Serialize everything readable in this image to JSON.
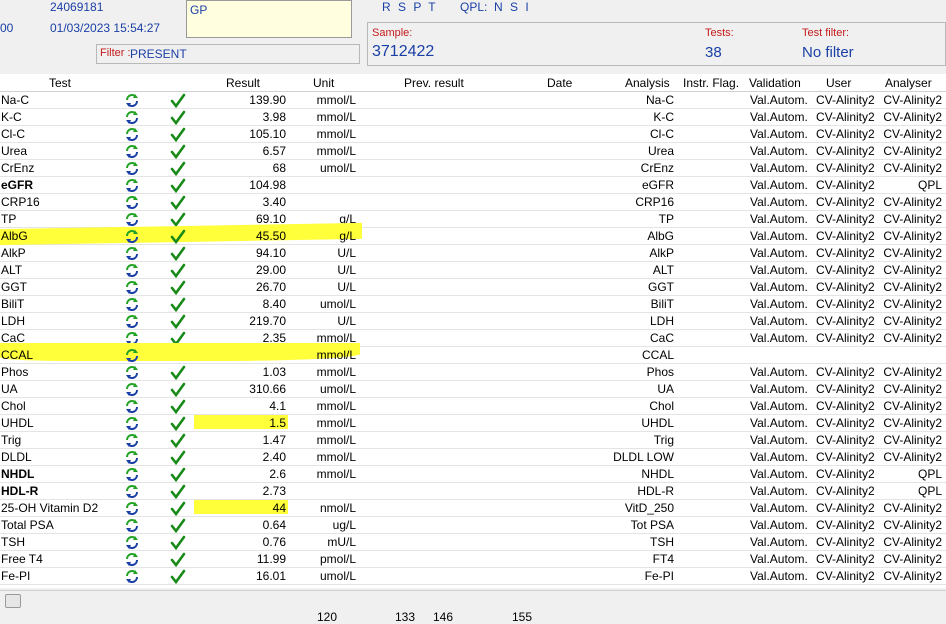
{
  "header": {
    "patient_id": "24069181",
    "left_fragment": "00",
    "datetime": "01/03/2023 15:54:27",
    "location": "GP",
    "filter_label": "Filter :",
    "filter_value": "PRESENT",
    "status_letters": "R S P T",
    "qpl_label": "QPL:",
    "qpl_letters": "N S I",
    "sample_label": "Sample:",
    "sample_value": "3712422",
    "tests_label": "Tests:",
    "tests_value": "38",
    "testfilter_label": "Test filter:",
    "testfilter_value": "No filter"
  },
  "columns": {
    "test": "Test",
    "result": "Result",
    "unit": "Unit",
    "prev": "Prev. result",
    "date": "Date",
    "analysis": "Analysis",
    "flag": "Instr. Flag.",
    "validation": "Validation",
    "user": "User",
    "analyser": "Analyser"
  },
  "rows": [
    {
      "test": "Na-C",
      "result": "139.90",
      "unit": "mmol/L",
      "analysis": "Na-C",
      "validation": "Val.Autom.",
      "user": "CV-Alinity2",
      "analyser": "CV-Alinity2",
      "bold": false,
      "check": true
    },
    {
      "test": "K-C",
      "result": "3.98",
      "unit": "mmol/L",
      "analysis": "K-C",
      "validation": "Val.Autom.",
      "user": "CV-Alinity2",
      "analyser": "CV-Alinity2",
      "bold": false,
      "check": true
    },
    {
      "test": "Cl-C",
      "result": "105.10",
      "unit": "mmol/L",
      "analysis": "Cl-C",
      "validation": "Val.Autom.",
      "user": "CV-Alinity2",
      "analyser": "CV-Alinity2",
      "bold": false,
      "check": true
    },
    {
      "test": "Urea",
      "result": "6.57",
      "unit": "mmol/L",
      "analysis": "Urea",
      "validation": "Val.Autom.",
      "user": "CV-Alinity2",
      "analyser": "CV-Alinity2",
      "bold": false,
      "check": true
    },
    {
      "test": "CrEnz",
      "result": "68",
      "unit": "umol/L",
      "analysis": "CrEnz",
      "validation": "Val.Autom.",
      "user": "CV-Alinity2",
      "analyser": "CV-Alinity2",
      "bold": false,
      "check": true
    },
    {
      "test": "eGFR",
      "result": "104.98",
      "unit": "",
      "analysis": "eGFR",
      "validation": "Val.Autom.",
      "user": "CV-Alinity2",
      "analyser": "QPL",
      "bold": true,
      "check": true
    },
    {
      "test": "CRP16",
      "result": "3.40",
      "unit": "",
      "analysis": "CRP16",
      "validation": "Val.Autom.",
      "user": "CV-Alinity2",
      "analyser": "CV-Alinity2",
      "bold": false,
      "check": true
    },
    {
      "test": "TP",
      "result": "69.10",
      "unit": "g/L",
      "analysis": "TP",
      "validation": "Val.Autom.",
      "user": "CV-Alinity2",
      "analyser": "CV-Alinity2",
      "bold": false,
      "check": true
    },
    {
      "test": "AlbG",
      "result": "45.50",
      "unit": "g/L",
      "analysis": "AlbG",
      "validation": "Val.Autom.",
      "user": "CV-Alinity2",
      "analyser": "CV-Alinity2",
      "bold": false,
      "check": true
    },
    {
      "test": "AlkP",
      "result": "94.10",
      "unit": "U/L",
      "analysis": "AlkP",
      "validation": "Val.Autom.",
      "user": "CV-Alinity2",
      "analyser": "CV-Alinity2",
      "bold": false,
      "check": true
    },
    {
      "test": "ALT",
      "result": "29.00",
      "unit": "U/L",
      "analysis": "ALT",
      "validation": "Val.Autom.",
      "user": "CV-Alinity2",
      "analyser": "CV-Alinity2",
      "bold": false,
      "check": true
    },
    {
      "test": "GGT",
      "result": "26.70",
      "unit": "U/L",
      "analysis": "GGT",
      "validation": "Val.Autom.",
      "user": "CV-Alinity2",
      "analyser": "CV-Alinity2",
      "bold": false,
      "check": true
    },
    {
      "test": "BiliT",
      "result": "8.40",
      "unit": "umol/L",
      "analysis": "BiliT",
      "validation": "Val.Autom.",
      "user": "CV-Alinity2",
      "analyser": "CV-Alinity2",
      "bold": false,
      "check": true
    },
    {
      "test": "LDH",
      "result": "219.70",
      "unit": "U/L",
      "analysis": "LDH",
      "validation": "Val.Autom.",
      "user": "CV-Alinity2",
      "analyser": "CV-Alinity2",
      "bold": false,
      "check": true
    },
    {
      "test": "CaC",
      "result": "2.35",
      "unit": "mmol/L",
      "analysis": "CaC",
      "validation": "Val.Autom.",
      "user": "CV-Alinity2",
      "analyser": "CV-Alinity2",
      "bold": false,
      "check": true
    },
    {
      "test": "CCAL",
      "result": "",
      "unit": "mmol/L",
      "analysis": "CCAL",
      "validation": "",
      "user": "",
      "analyser": "",
      "bold": false,
      "check": false
    },
    {
      "test": "Phos",
      "result": "1.03",
      "unit": "mmol/L",
      "analysis": "Phos",
      "validation": "Val.Autom.",
      "user": "CV-Alinity2",
      "analyser": "CV-Alinity2",
      "bold": false,
      "check": true
    },
    {
      "test": "UA",
      "result": "310.66",
      "unit": "umol/L",
      "analysis": "UA",
      "validation": "Val.Autom.",
      "user": "CV-Alinity2",
      "analyser": "CV-Alinity2",
      "bold": false,
      "check": true
    },
    {
      "test": "Chol",
      "result": "4.1",
      "unit": "mmol/L",
      "analysis": "Chol",
      "validation": "Val.Autom.",
      "user": "CV-Alinity2",
      "analyser": "CV-Alinity2",
      "bold": false,
      "check": true
    },
    {
      "test": "UHDL",
      "result": "1.5",
      "unit": "mmol/L",
      "analysis": "UHDL",
      "validation": "Val.Autom.",
      "user": "CV-Alinity2",
      "analyser": "CV-Alinity2",
      "bold": false,
      "check": true
    },
    {
      "test": "Trig",
      "result": "1.47",
      "unit": "mmol/L",
      "analysis": "Trig",
      "validation": "Val.Autom.",
      "user": "CV-Alinity2",
      "analyser": "CV-Alinity2",
      "bold": false,
      "check": true
    },
    {
      "test": "DLDL",
      "result": "2.40",
      "unit": "mmol/L",
      "analysis": "DLDL LOW",
      "validation": "Val.Autom.",
      "user": "CV-Alinity2",
      "analyser": "CV-Alinity2",
      "bold": false,
      "check": true
    },
    {
      "test": "NHDL",
      "result": "2.6",
      "unit": "mmol/L",
      "analysis": "NHDL",
      "validation": "Val.Autom.",
      "user": "CV-Alinity2",
      "analyser": "QPL",
      "bold": true,
      "check": true
    },
    {
      "test": "HDL-R",
      "result": "2.73",
      "unit": "",
      "analysis": "HDL-R",
      "validation": "Val.Autom.",
      "user": "CV-Alinity2",
      "analyser": "QPL",
      "bold": true,
      "check": true
    },
    {
      "test": "25-OH Vitamin D2",
      "result": "44",
      "unit": "nmol/L",
      "analysis": "VitD_250",
      "validation": "Val.Autom.",
      "user": "CV-Alinity2",
      "analyser": "CV-Alinity2",
      "bold": false,
      "check": true
    },
    {
      "test": "Total PSA",
      "result": "0.64",
      "unit": "ug/L",
      "analysis": "Tot PSA",
      "validation": "Val.Autom.",
      "user": "CV-Alinity2",
      "analyser": "CV-Alinity2",
      "bold": false,
      "check": true
    },
    {
      "test": "TSH",
      "result": "0.76",
      "unit": "mU/L",
      "analysis": "TSH",
      "validation": "Val.Autom.",
      "user": "CV-Alinity2",
      "analyser": "CV-Alinity2",
      "bold": false,
      "check": true
    },
    {
      "test": "Free T4",
      "result": "11.99",
      "unit": "pmol/L",
      "analysis": "FT4",
      "validation": "Val.Autom.",
      "user": "CV-Alinity2",
      "analyser": "CV-Alinity2",
      "bold": false,
      "check": true
    },
    {
      "test": "Fe-PI",
      "result": "16.01",
      "unit": "umol/L",
      "analysis": "Fe-PI",
      "validation": "Val.Autom.",
      "user": "CV-Alinity2",
      "analyser": "CV-Alinity2",
      "bold": false,
      "check": true
    }
  ],
  "footer": {
    "n1": "120",
    "n2": "133",
    "n3": "146",
    "n4": "155"
  },
  "colors": {
    "highlight": "#ffff3a",
    "check": "#178a17",
    "refresh_blue": "#1a3fa6",
    "refresh_green": "#23a323"
  }
}
